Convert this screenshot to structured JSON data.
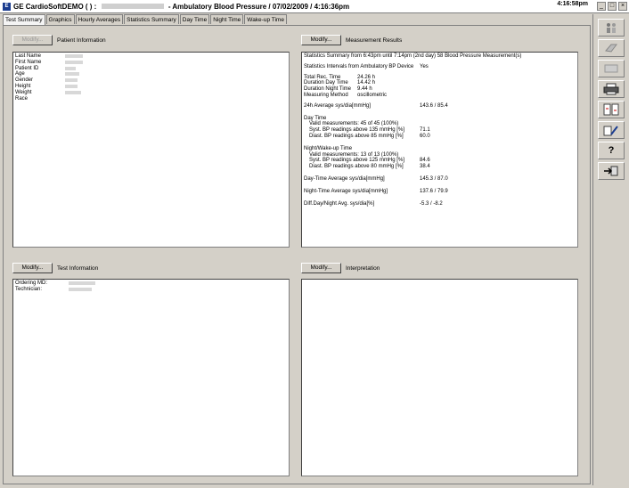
{
  "window": {
    "app": "GE CardioSoftDEMO",
    "paren": "( ) :",
    "title_rest": "-   Ambulatory Blood Pressure / 07/02/2009 /   4:16:36pm",
    "clock": "4:16:58pm"
  },
  "tabs": [
    "Test Summary",
    "Graphics",
    "Hourly Averages",
    "Statistics Summary",
    "Day Time",
    "Night Time",
    "Wake-up Time"
  ],
  "patient": {
    "modify": "Modify...",
    "title": "Patient Information",
    "fields": [
      "Last Name",
      "First Name",
      "Patient ID",
      "Age",
      "Gender",
      "Height",
      "Weight",
      "Race"
    ]
  },
  "measurement": {
    "modify": "Modify...",
    "title": "Measurement Results",
    "summary_line": "Statistics Summary from  6:43pm until  7:14pm (2nd day)     58 Blood Pressure Measurement(s)",
    "intervals_label": "Statistics Intervals from Ambulatory BP Device",
    "intervals_value": "Yes",
    "rows1": [
      {
        "k": "Total Rec. Time",
        "v": "24.26 h"
      },
      {
        "k": "Duration Day Time",
        "v": "14.42 h"
      },
      {
        "k": "Duration Night Time",
        "v": "9.44 h"
      },
      {
        "k": "Measuring Method",
        "v": "oscillometric"
      }
    ],
    "avg24_label": "24h Average sys/dia[mmHg]",
    "avg24_value": "143.6 / 85.4",
    "day_title": "Day Time",
    "day_valid": "Valid measurements: 45 of 45 (100%)",
    "day_syst_label": "Syst. BP readings above 135 mmHg [%]",
    "day_syst_value": "71.1",
    "day_diast_label": "Diast. BP readings above 85 mmHg [%]",
    "day_diast_value": "60.0",
    "night_title": "Night/Wake-up Time",
    "night_valid": "Valid measurements: 13 of 13 (100%)",
    "night_syst_label": "Syst. BP readings above 125 mmHg [%]",
    "night_syst_value": "84.6",
    "night_diast_label": "Diast. BP readings above 80 mmHg [%]",
    "night_diast_value": "38.4",
    "day_avg_label": "Day-Time Average sys/dia[mmHg]",
    "day_avg_value": "145.3 / 87.0",
    "night_avg_label": "Night-Time Average sys/dia[mmHg]",
    "night_avg_value": "137.6 / 79.9",
    "diff_label": "Diff.Day/Night Avg. sys/dia[%]",
    "diff_value": "-5.3  / -8.2"
  },
  "test": {
    "modify": "Modify...",
    "title": "Test Information",
    "fields": [
      "Ordering MD:",
      "Technician:"
    ]
  },
  "interpretation": {
    "modify": "Modify...",
    "title": "Interpretation"
  },
  "sidebar": {
    "help": "?",
    "icons": [
      "patients-icon",
      "eraser-icon",
      "stamp-icon",
      "printer-icon",
      "compare-icon",
      "edit-icon",
      "help-icon",
      "exit-icon"
    ]
  }
}
